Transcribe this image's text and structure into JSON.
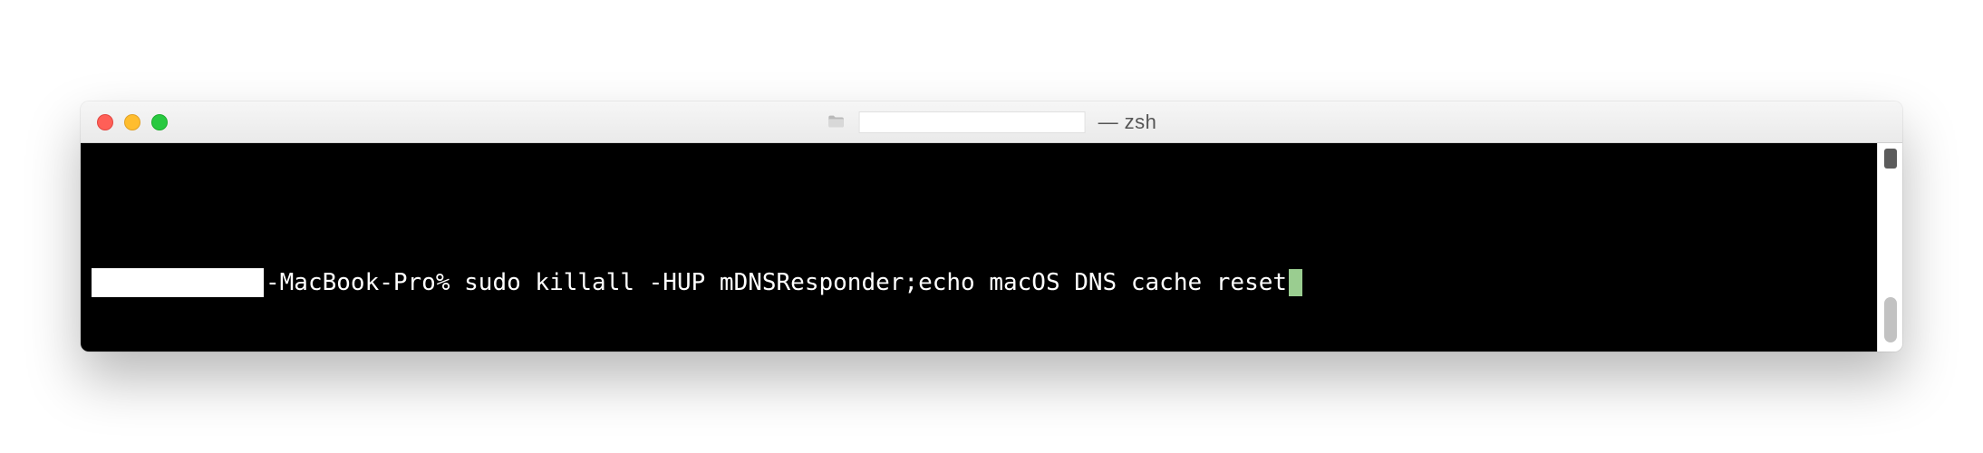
{
  "window": {
    "title_suffix": "— zsh"
  },
  "terminal": {
    "prompt_host": "-MacBook-Pro% ",
    "command": "sudo killall -HUP mDNSResponder;echo macOS DNS cache reset"
  }
}
